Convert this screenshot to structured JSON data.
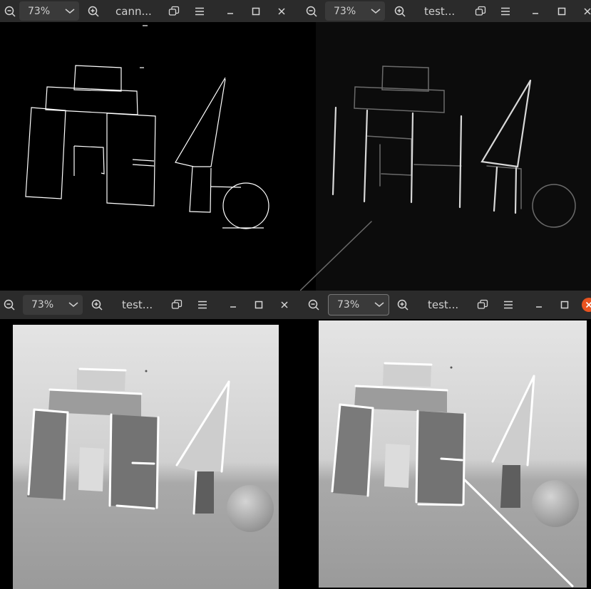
{
  "windows": [
    {
      "id": "top-left",
      "zoom": "73%",
      "title": "cann...",
      "image": "canny edges"
    },
    {
      "id": "top-right",
      "zoom": "73%",
      "title": "test...",
      "image": "gradient magnitude"
    },
    {
      "id": "bottom-left",
      "zoom": "73%",
      "title": "test...",
      "image": "detected lines overlay"
    },
    {
      "id": "bottom-right",
      "zoom": "73%",
      "title": "test...",
      "image": "detected lines overlay with diagonal"
    }
  ],
  "icons": [
    "zoom-out-icon",
    "chevron-down-icon",
    "zoom-in-icon",
    "restore-icon",
    "menu-icon",
    "minimize-icon",
    "maximize-icon",
    "close-icon"
  ],
  "colors": {
    "titlebar": "#2b2b2b",
    "zoom_box": "#3a3a3a",
    "close_active": "#e95420",
    "line_overlay": "#ffffff"
  }
}
